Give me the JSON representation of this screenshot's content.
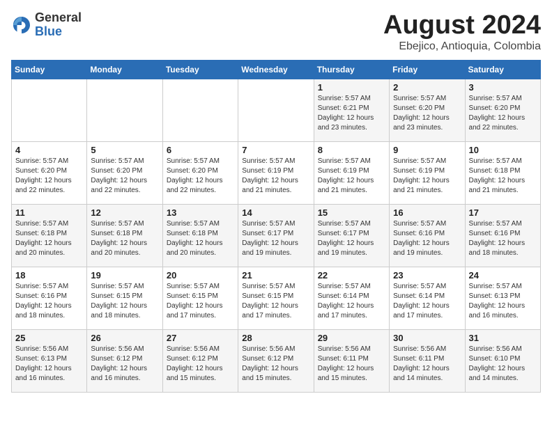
{
  "header": {
    "logo_general": "General",
    "logo_blue": "Blue",
    "month_year": "August 2024",
    "location": "Ebejico, Antioquia, Colombia"
  },
  "days_of_week": [
    "Sunday",
    "Monday",
    "Tuesday",
    "Wednesday",
    "Thursday",
    "Friday",
    "Saturday"
  ],
  "weeks": [
    [
      {
        "day": "",
        "info": ""
      },
      {
        "day": "",
        "info": ""
      },
      {
        "day": "",
        "info": ""
      },
      {
        "day": "",
        "info": ""
      },
      {
        "day": "1",
        "info": "Sunrise: 5:57 AM\nSunset: 6:21 PM\nDaylight: 12 hours\nand 23 minutes."
      },
      {
        "day": "2",
        "info": "Sunrise: 5:57 AM\nSunset: 6:20 PM\nDaylight: 12 hours\nand 23 minutes."
      },
      {
        "day": "3",
        "info": "Sunrise: 5:57 AM\nSunset: 6:20 PM\nDaylight: 12 hours\nand 22 minutes."
      }
    ],
    [
      {
        "day": "4",
        "info": "Sunrise: 5:57 AM\nSunset: 6:20 PM\nDaylight: 12 hours\nand 22 minutes."
      },
      {
        "day": "5",
        "info": "Sunrise: 5:57 AM\nSunset: 6:20 PM\nDaylight: 12 hours\nand 22 minutes."
      },
      {
        "day": "6",
        "info": "Sunrise: 5:57 AM\nSunset: 6:20 PM\nDaylight: 12 hours\nand 22 minutes."
      },
      {
        "day": "7",
        "info": "Sunrise: 5:57 AM\nSunset: 6:19 PM\nDaylight: 12 hours\nand 21 minutes."
      },
      {
        "day": "8",
        "info": "Sunrise: 5:57 AM\nSunset: 6:19 PM\nDaylight: 12 hours\nand 21 minutes."
      },
      {
        "day": "9",
        "info": "Sunrise: 5:57 AM\nSunset: 6:19 PM\nDaylight: 12 hours\nand 21 minutes."
      },
      {
        "day": "10",
        "info": "Sunrise: 5:57 AM\nSunset: 6:18 PM\nDaylight: 12 hours\nand 21 minutes."
      }
    ],
    [
      {
        "day": "11",
        "info": "Sunrise: 5:57 AM\nSunset: 6:18 PM\nDaylight: 12 hours\nand 20 minutes."
      },
      {
        "day": "12",
        "info": "Sunrise: 5:57 AM\nSunset: 6:18 PM\nDaylight: 12 hours\nand 20 minutes."
      },
      {
        "day": "13",
        "info": "Sunrise: 5:57 AM\nSunset: 6:18 PM\nDaylight: 12 hours\nand 20 minutes."
      },
      {
        "day": "14",
        "info": "Sunrise: 5:57 AM\nSunset: 6:17 PM\nDaylight: 12 hours\nand 19 minutes."
      },
      {
        "day": "15",
        "info": "Sunrise: 5:57 AM\nSunset: 6:17 PM\nDaylight: 12 hours\nand 19 minutes."
      },
      {
        "day": "16",
        "info": "Sunrise: 5:57 AM\nSunset: 6:16 PM\nDaylight: 12 hours\nand 19 minutes."
      },
      {
        "day": "17",
        "info": "Sunrise: 5:57 AM\nSunset: 6:16 PM\nDaylight: 12 hours\nand 18 minutes."
      }
    ],
    [
      {
        "day": "18",
        "info": "Sunrise: 5:57 AM\nSunset: 6:16 PM\nDaylight: 12 hours\nand 18 minutes."
      },
      {
        "day": "19",
        "info": "Sunrise: 5:57 AM\nSunset: 6:15 PM\nDaylight: 12 hours\nand 18 minutes."
      },
      {
        "day": "20",
        "info": "Sunrise: 5:57 AM\nSunset: 6:15 PM\nDaylight: 12 hours\nand 17 minutes."
      },
      {
        "day": "21",
        "info": "Sunrise: 5:57 AM\nSunset: 6:15 PM\nDaylight: 12 hours\nand 17 minutes."
      },
      {
        "day": "22",
        "info": "Sunrise: 5:57 AM\nSunset: 6:14 PM\nDaylight: 12 hours\nand 17 minutes."
      },
      {
        "day": "23",
        "info": "Sunrise: 5:57 AM\nSunset: 6:14 PM\nDaylight: 12 hours\nand 17 minutes."
      },
      {
        "day": "24",
        "info": "Sunrise: 5:57 AM\nSunset: 6:13 PM\nDaylight: 12 hours\nand 16 minutes."
      }
    ],
    [
      {
        "day": "25",
        "info": "Sunrise: 5:56 AM\nSunset: 6:13 PM\nDaylight: 12 hours\nand 16 minutes."
      },
      {
        "day": "26",
        "info": "Sunrise: 5:56 AM\nSunset: 6:12 PM\nDaylight: 12 hours\nand 16 minutes."
      },
      {
        "day": "27",
        "info": "Sunrise: 5:56 AM\nSunset: 6:12 PM\nDaylight: 12 hours\nand 15 minutes."
      },
      {
        "day": "28",
        "info": "Sunrise: 5:56 AM\nSunset: 6:12 PM\nDaylight: 12 hours\nand 15 minutes."
      },
      {
        "day": "29",
        "info": "Sunrise: 5:56 AM\nSunset: 6:11 PM\nDaylight: 12 hours\nand 15 minutes."
      },
      {
        "day": "30",
        "info": "Sunrise: 5:56 AM\nSunset: 6:11 PM\nDaylight: 12 hours\nand 14 minutes."
      },
      {
        "day": "31",
        "info": "Sunrise: 5:56 AM\nSunset: 6:10 PM\nDaylight: 12 hours\nand 14 minutes."
      }
    ]
  ]
}
